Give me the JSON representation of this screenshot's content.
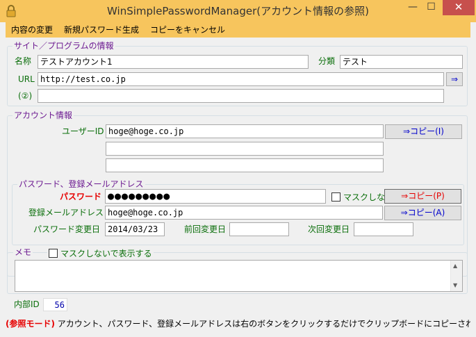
{
  "window": {
    "title": "WinSimplePasswordManager(アカウント情報の参照)",
    "min_glyph": "—",
    "max_glyph": "☐",
    "close_glyph": "✕"
  },
  "menu": [
    "内容の変更",
    "新規パスワード生成",
    "コピーをキャンセル"
  ],
  "site": {
    "legend": "サイト／プログラムの情報",
    "name_label": "名称",
    "name_value": "テストアカウント1",
    "category_label": "分類",
    "category_value": "テスト",
    "url_label": "URL",
    "url_value": "http://test.co.jp",
    "url_open_label": "⇒",
    "url2_label": "(②)",
    "url2_value": ""
  },
  "account": {
    "legend": "アカウント情報",
    "user_id_label": "ユーザーID",
    "user_id_value": "hoge@hoge.co.jp",
    "user_id_copy": "⇒コピー(I)",
    "extra1": "",
    "extra2": ""
  },
  "password": {
    "legend": "パスワード、登録メールアドレス",
    "password_label": "パスワード",
    "password_value": "●●●●●●●●●",
    "no_mask_label": "マスクしない",
    "password_copy": "⇒コピー(P)",
    "email_label": "登録メールアドレス",
    "email_value": "hoge@hoge.co.jp",
    "email_copy": "⇒コピー(A)",
    "changed_label": "パスワード変更日",
    "changed_value": "2014/03/23",
    "prev_label": "前回変更日",
    "prev_value": "",
    "next_label": "次回変更日",
    "next_value": ""
  },
  "memo": {
    "legend": "メモ",
    "show_unmasked_label": "マスクしないで表示する",
    "value": ""
  },
  "internal_id": {
    "label": "内部ID",
    "value": "56"
  },
  "status": {
    "mode": "(参照モード)",
    "text": " アカウント、パスワード、登録メールアドレスは右のボタンをクリックするだけでクリップボードにコピーされます。"
  },
  "colors": {
    "titlebar": "#f7c55d",
    "close": "#c7504d",
    "legend": "#6c1a91",
    "label": "#0a6e0a",
    "alert": "#e60000",
    "link_button": "#0000cc"
  }
}
